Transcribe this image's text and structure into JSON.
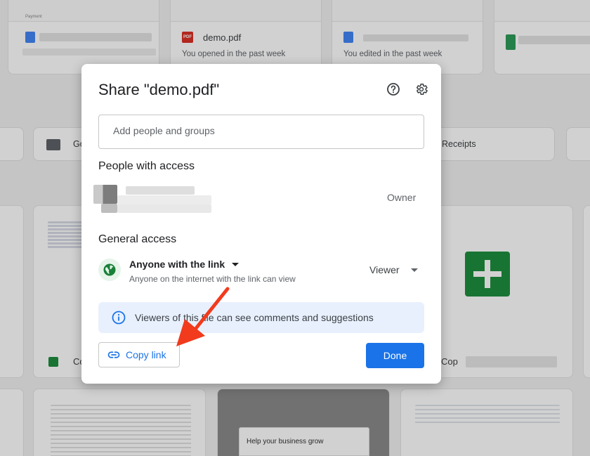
{
  "background": {
    "cards": [
      {
        "thumb_text": "Payment"
      },
      {
        "title": "demo.pdf",
        "pdf_badge": "PDF",
        "subtitle": "You opened in the past week"
      },
      {
        "subtitle": "You edited in the past week"
      }
    ],
    "folders": [
      {
        "name": "Go"
      },
      {
        "name": "Receipts"
      }
    ],
    "bottom_labels": [
      "Co",
      "Cop"
    ],
    "grow_text": "Help your business grow"
  },
  "dialog": {
    "title": "Share \"demo.pdf\"",
    "add_placeholder": "Add people and groups",
    "people_heading": "People with access",
    "owner_label": "Owner",
    "general_heading": "General access",
    "access_title": "Anyone with the link",
    "access_subtitle": "Anyone on the internet with the link can view",
    "role": "Viewer",
    "info_text": "Viewers of this file can see comments and suggestions",
    "copy_label": "Copy link",
    "done_label": "Done"
  },
  "colors": {
    "primary": "#1a73e8",
    "annotation_arrow": "#f23a1d"
  },
  "icons": [
    "help-icon",
    "settings-icon",
    "globe-icon",
    "info-icon",
    "link-icon"
  ]
}
